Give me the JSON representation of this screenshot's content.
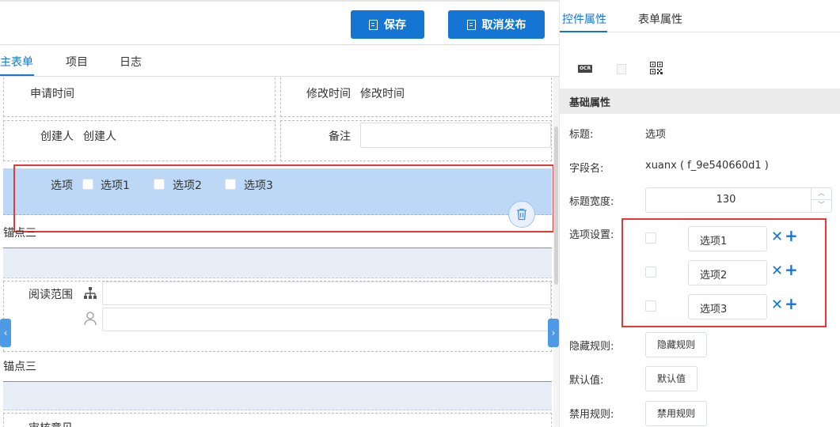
{
  "toolbar": {
    "save_label": "保存",
    "unpublish_label": "取消发布"
  },
  "tabs": [
    {
      "label": "主表单"
    },
    {
      "label": "项目"
    },
    {
      "label": "日志"
    }
  ],
  "form": {
    "apply_time_label": "申请时间",
    "modify_time_label": "修改时间",
    "modify_time_value": "修改时间",
    "creator_label": "创建人",
    "creator_value": "创建人",
    "remark_label": "备注",
    "option_label": "选项",
    "options": [
      {
        "label": "选项1"
      },
      {
        "label": "选项2"
      },
      {
        "label": "选项3"
      }
    ],
    "anchor1_label": "锚点三",
    "read_scope_label": "阅读范围",
    "anchor2_label": "锚点三",
    "approval_label": "审核意见"
  },
  "panel": {
    "tabs": [
      {
        "label": "控件属性"
      },
      {
        "label": "表单属性"
      }
    ],
    "tool_icons": [
      "ocr-icon",
      "blank-icon",
      "qrcode-icon"
    ],
    "ocr_text": "OCR",
    "section_title": "基础属性",
    "props": {
      "title_label": "标题:",
      "title_value": "选项",
      "field_label": "字段名:",
      "field_value": "xuanx ( f_9e540660d1 )",
      "width_label": "标题宽度:",
      "width_value": "130",
      "options_label": "选项设置:",
      "option_items": [
        {
          "label": "选项1"
        },
        {
          "label": "选项2"
        },
        {
          "label": "选项3"
        }
      ],
      "hide_label": "隐藏规则:",
      "hide_button": "隐藏规则",
      "default_label": "默认值:",
      "default_button": "默认值",
      "disable_label": "禁用规则:",
      "disable_button": "禁用规则"
    }
  },
  "colors": {
    "accent": "#1476d2",
    "selected_row": "#bcd8f6",
    "highlight_box": "#e53935"
  }
}
